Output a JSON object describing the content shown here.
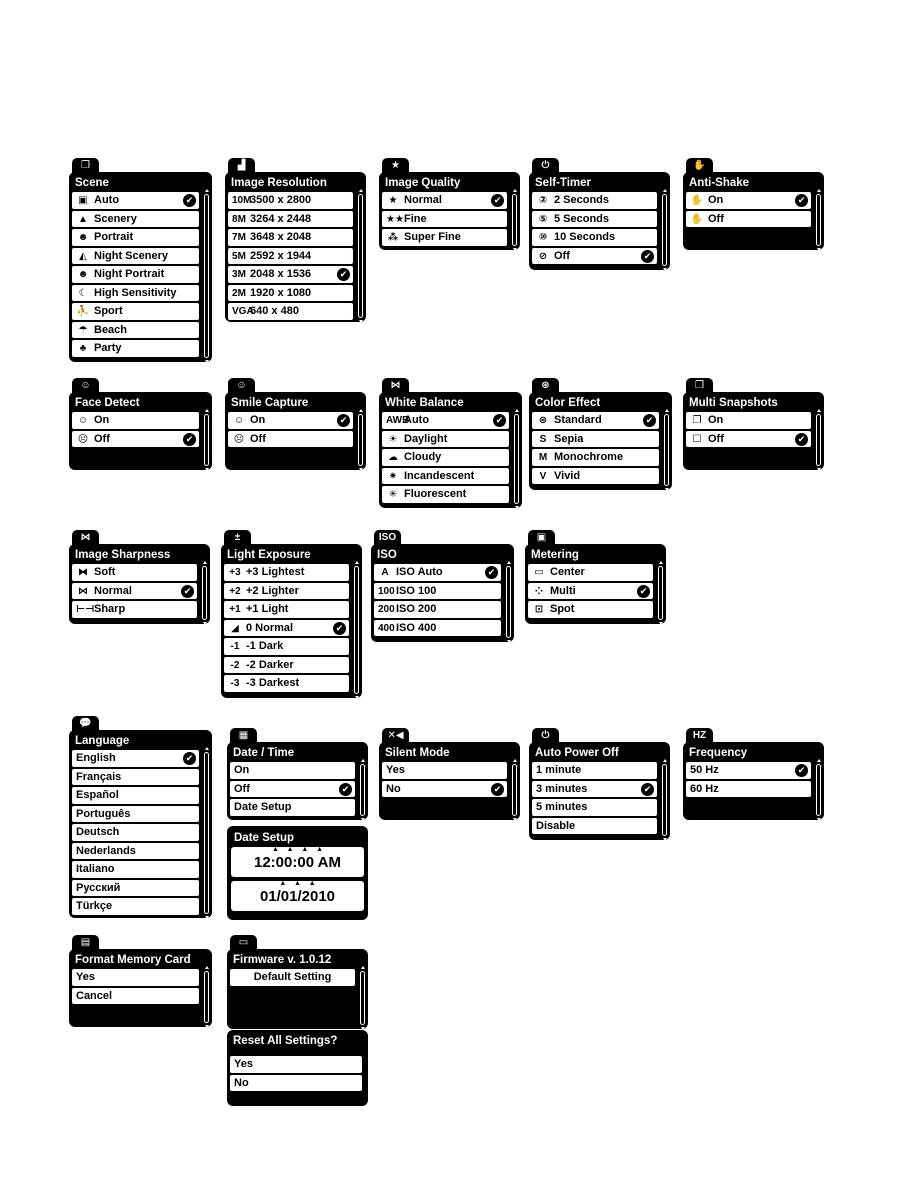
{
  "menus": [
    {
      "id": "scene",
      "tab_icon": "scene-icon",
      "tab_glyph": "❐",
      "title": "Scene",
      "scroll": true,
      "items": [
        {
          "label": "Auto",
          "icon": "auto-icon",
          "glyph": "▣",
          "checked": true
        },
        {
          "label": "Scenery",
          "icon": "scenery-icon",
          "glyph": "▲",
          "checked": false
        },
        {
          "label": "Portrait",
          "icon": "portrait-icon",
          "glyph": "☻",
          "checked": false
        },
        {
          "label": "Night Scenery",
          "icon": "night-scenery-icon",
          "glyph": "◭",
          "checked": false
        },
        {
          "label": "Night Portrait",
          "icon": "night-portrait-icon",
          "glyph": "☻",
          "checked": false
        },
        {
          "label": "High Sensitivity",
          "icon": "moon-icon",
          "glyph": "☾",
          "checked": false
        },
        {
          "label": "Sport",
          "icon": "sport-icon",
          "glyph": "⛹",
          "checked": false
        },
        {
          "label": "Beach",
          "icon": "beach-icon",
          "glyph": "☂",
          "checked": false
        },
        {
          "label": "Party",
          "icon": "party-icon",
          "glyph": "♣",
          "checked": false
        }
      ]
    },
    {
      "id": "image-resolution",
      "tab_icon": "resolution-icon",
      "tab_glyph": "▟",
      "title": "Image Resolution",
      "scroll": true,
      "items": [
        {
          "label": "3500 x 2800",
          "icon": "10m-icon",
          "glyph": "10M",
          "checked": false
        },
        {
          "label": "3264 x 2448",
          "icon": "8m-icon",
          "glyph": "8M",
          "checked": false
        },
        {
          "label": "3648 x 2048",
          "icon": "7m-hd-icon",
          "glyph": "7M",
          "checked": false
        },
        {
          "label": "2592 x 1944",
          "icon": "5m-icon",
          "glyph": "5M",
          "checked": false
        },
        {
          "label": "2048 x 1536",
          "icon": "3m-icon",
          "glyph": "3M",
          "checked": true
        },
        {
          "label": "1920 x 1080",
          "icon": "2m-hd-icon",
          "glyph": "2M",
          "checked": false
        },
        {
          "label": "640 x 480",
          "icon": "vga-icon",
          "glyph": "VGA",
          "checked": false
        }
      ]
    },
    {
      "id": "image-quality",
      "tab_icon": "star-icon",
      "tab_glyph": "★",
      "title": "Image Quality",
      "scroll": true,
      "items": [
        {
          "label": "Normal",
          "icon": "star-icon",
          "glyph": "★",
          "checked": true
        },
        {
          "label": "Fine",
          "icon": "two-stars-icon",
          "glyph": "★★",
          "checked": false
        },
        {
          "label": "Super Fine",
          "icon": "three-stars-icon",
          "glyph": "⁂",
          "checked": false
        }
      ]
    },
    {
      "id": "self-timer",
      "tab_icon": "timer-icon",
      "tab_glyph": "⏻",
      "title": "Self-Timer",
      "scroll": true,
      "items": [
        {
          "label": "2 Seconds",
          "icon": "timer-2-icon",
          "glyph": "②",
          "checked": false
        },
        {
          "label": "5 Seconds",
          "icon": "timer-5-icon",
          "glyph": "⑤",
          "checked": false
        },
        {
          "label": "10 Seconds",
          "icon": "timer-10-icon",
          "glyph": "⑩",
          "checked": false
        },
        {
          "label": "Off",
          "icon": "timer-off-icon",
          "glyph": "⊘",
          "checked": true
        }
      ]
    },
    {
      "id": "anti-shake",
      "tab_icon": "hand-icon",
      "tab_glyph": "✋",
      "title": "Anti-Shake",
      "scroll": true,
      "items": [
        {
          "label": "On",
          "icon": "hand-shake-on-icon",
          "glyph": "✋",
          "checked": true
        },
        {
          "label": "Off",
          "icon": "hand-shake-off-icon",
          "glyph": "✋",
          "checked": false
        }
      ]
    },
    {
      "id": "face-detect",
      "tab_icon": "face-icon",
      "tab_glyph": "☺",
      "title": "Face Detect",
      "scroll": true,
      "items": [
        {
          "label": "On",
          "icon": "face-on-icon",
          "glyph": "☺",
          "checked": false
        },
        {
          "label": "Off",
          "icon": "face-off-icon",
          "glyph": "☹",
          "checked": true
        }
      ]
    },
    {
      "id": "smile-capture",
      "tab_icon": "smile-icon",
      "tab_glyph": "☺",
      "title": "Smile Capture",
      "scroll": true,
      "items": [
        {
          "label": "On",
          "icon": "smile-on-icon",
          "glyph": "☺",
          "checked": true
        },
        {
          "label": "Off",
          "icon": "smile-off-icon",
          "glyph": "☹",
          "checked": false
        }
      ]
    },
    {
      "id": "white-balance",
      "tab_icon": "white-balance-icon",
      "tab_glyph": "⋈",
      "title": "White Balance",
      "scroll": true,
      "items": [
        {
          "label": "Auto",
          "icon": "awb-icon",
          "glyph": "AWB",
          "checked": true
        },
        {
          "label": "Daylight",
          "icon": "sun-icon",
          "glyph": "☀",
          "checked": false
        },
        {
          "label": "Cloudy",
          "icon": "cloud-icon",
          "glyph": "☁",
          "checked": false
        },
        {
          "label": "Incandescent",
          "icon": "bulb-icon",
          "glyph": "✷",
          "checked": false
        },
        {
          "label": "Fluorescent",
          "icon": "fluorescent-icon",
          "glyph": "✳",
          "checked": false
        }
      ]
    },
    {
      "id": "color-effect",
      "tab_icon": "color-effect-icon",
      "tab_glyph": "⊛",
      "title": "Color Effect",
      "scroll": true,
      "items": [
        {
          "label": "Standard",
          "icon": "standard-color-icon",
          "glyph": "⊛",
          "checked": true
        },
        {
          "label": "Sepia",
          "icon": "sepia-icon",
          "glyph": "S",
          "checked": false
        },
        {
          "label": "Monochrome",
          "icon": "monochrome-icon",
          "glyph": "M",
          "checked": false
        },
        {
          "label": "Vivid",
          "icon": "vivid-icon",
          "glyph": "V",
          "checked": false
        }
      ]
    },
    {
      "id": "multi-snapshots",
      "tab_icon": "multi-snap-icon",
      "tab_glyph": "❐",
      "title": "Multi Snapshots",
      "scroll": true,
      "items": [
        {
          "label": "On",
          "icon": "multi-frame-icon",
          "glyph": "❐",
          "checked": false
        },
        {
          "label": "Off",
          "icon": "single-frame-icon",
          "glyph": "☐",
          "checked": true
        }
      ]
    },
    {
      "id": "image-sharpness",
      "tab_icon": "sharpness-icon",
      "tab_glyph": "⋈",
      "title": "Image Sharpness",
      "scroll": true,
      "items": [
        {
          "label": "Soft",
          "icon": "soft-icon",
          "glyph": "⧓",
          "checked": false
        },
        {
          "label": "Normal",
          "icon": "normal-sharp-icon",
          "glyph": "⋈",
          "checked": true
        },
        {
          "label": "Sharp",
          "icon": "sharp-icon",
          "glyph": "⊢⊣",
          "checked": false
        }
      ]
    },
    {
      "id": "light-exposure",
      "tab_icon": "exposure-icon",
      "tab_glyph": "±",
      "title": "Light Exposure",
      "scroll": true,
      "items": [
        {
          "label": "+3 Lightest",
          "icon": "exposure-plus3-icon",
          "glyph": "+3",
          "checked": false
        },
        {
          "label": "+2 Lighter",
          "icon": "exposure-plus2-icon",
          "glyph": "+2",
          "checked": false
        },
        {
          "label": "+1 Light",
          "icon": "exposure-plus1-icon",
          "glyph": "+1",
          "checked": false
        },
        {
          "label": "0 Normal",
          "icon": "exposure-zero-icon",
          "glyph": "◢",
          "checked": true
        },
        {
          "label": "-1 Dark",
          "icon": "exposure-minus1-icon",
          "glyph": "-1",
          "checked": false
        },
        {
          "label": "-2 Darker",
          "icon": "exposure-minus2-icon",
          "glyph": "-2",
          "checked": false
        },
        {
          "label": "-3 Darkest",
          "icon": "exposure-minus3-icon",
          "glyph": "-3",
          "checked": false
        }
      ]
    },
    {
      "id": "iso",
      "tab_icon": "iso-icon",
      "tab_glyph": "ISO",
      "title": "ISO",
      "scroll": true,
      "items": [
        {
          "label": "ISO Auto",
          "icon": "iso-auto-icon",
          "glyph": "A",
          "checked": true
        },
        {
          "label": "ISO 100",
          "icon": "iso-100-icon",
          "glyph": "100",
          "checked": false
        },
        {
          "label": "ISO 200",
          "icon": "iso-200-icon",
          "glyph": "200",
          "checked": false
        },
        {
          "label": "ISO 400",
          "icon": "iso-400-icon",
          "glyph": "400",
          "checked": false
        }
      ]
    },
    {
      "id": "metering",
      "tab_icon": "metering-icon",
      "tab_glyph": "▣",
      "title": "Metering",
      "scroll": true,
      "items": [
        {
          "label": "Center",
          "icon": "center-metering-icon",
          "glyph": "▭",
          "checked": false
        },
        {
          "label": "Multi",
          "icon": "multi-metering-icon",
          "glyph": "⁘",
          "checked": true
        },
        {
          "label": "Spot",
          "icon": "spot-metering-icon",
          "glyph": "⊡",
          "checked": false
        }
      ]
    },
    {
      "id": "language",
      "tab_icon": "speech-bubble-icon",
      "tab_glyph": "💬",
      "title": "Language",
      "scroll": true,
      "items": [
        {
          "label": "English",
          "checked": true
        },
        {
          "label": "Français",
          "checked": false
        },
        {
          "label": "Español",
          "checked": false
        },
        {
          "label": "Português",
          "checked": false
        },
        {
          "label": "Deutsch",
          "checked": false
        },
        {
          "label": "Nederlands",
          "checked": false
        },
        {
          "label": "Italiano",
          "checked": false
        },
        {
          "label": "Русский",
          "checked": false
        },
        {
          "label": "Türkçe",
          "checked": false
        }
      ]
    },
    {
      "id": "date-time",
      "tab_icon": "calendar-icon",
      "tab_glyph": "▦",
      "title": "Date / Time",
      "scroll": true,
      "items": [
        {
          "label": "On",
          "checked": false
        },
        {
          "label": "Off",
          "checked": true
        },
        {
          "label": "Date Setup",
          "checked": false
        }
      ]
    },
    {
      "id": "silent-mode",
      "tab_icon": "mute-icon",
      "tab_glyph": "✕◀",
      "title": "Silent Mode",
      "scroll": true,
      "items": [
        {
          "label": "Yes",
          "checked": false
        },
        {
          "label": "No",
          "checked": true
        }
      ]
    },
    {
      "id": "auto-power-off",
      "tab_icon": "power-icon",
      "tab_glyph": "⏻",
      "title": "Auto Power Off",
      "scroll": true,
      "items": [
        {
          "label": "1 minute",
          "checked": false
        },
        {
          "label": "3 minutes",
          "checked": true
        },
        {
          "label": "5 minutes",
          "checked": false
        },
        {
          "label": "Disable",
          "checked": false
        }
      ]
    },
    {
      "id": "frequency",
      "tab_icon": "hz-icon",
      "tab_glyph": "HZ",
      "title": "Frequency",
      "scroll": true,
      "items": [
        {
          "label": "50 Hz",
          "checked": true
        },
        {
          "label": "60 Hz",
          "checked": false
        }
      ]
    },
    {
      "id": "format-memory-card",
      "tab_icon": "sd-card-icon",
      "tab_glyph": "▤",
      "title": "Format Memory Card",
      "scroll": true,
      "items": [
        {
          "label": "Yes",
          "checked": false
        },
        {
          "label": "Cancel",
          "checked": false
        }
      ]
    },
    {
      "id": "firmware",
      "tab_icon": "firmware-icon",
      "tab_glyph": "▭",
      "title": "Firmware v. 1.0.12",
      "scroll": true,
      "centered": true,
      "items": [
        {
          "label": "Default Setting",
          "checked": false
        }
      ]
    },
    {
      "id": "reset-all-settings",
      "title": "Reset All Settings?",
      "scroll": false,
      "items": [
        {
          "label": "Yes",
          "checked": false
        },
        {
          "label": "No",
          "checked": false
        }
      ]
    }
  ],
  "date_setup": {
    "title": "Date Setup",
    "time": "12:00:00 AM",
    "date": "01/01/2010"
  }
}
